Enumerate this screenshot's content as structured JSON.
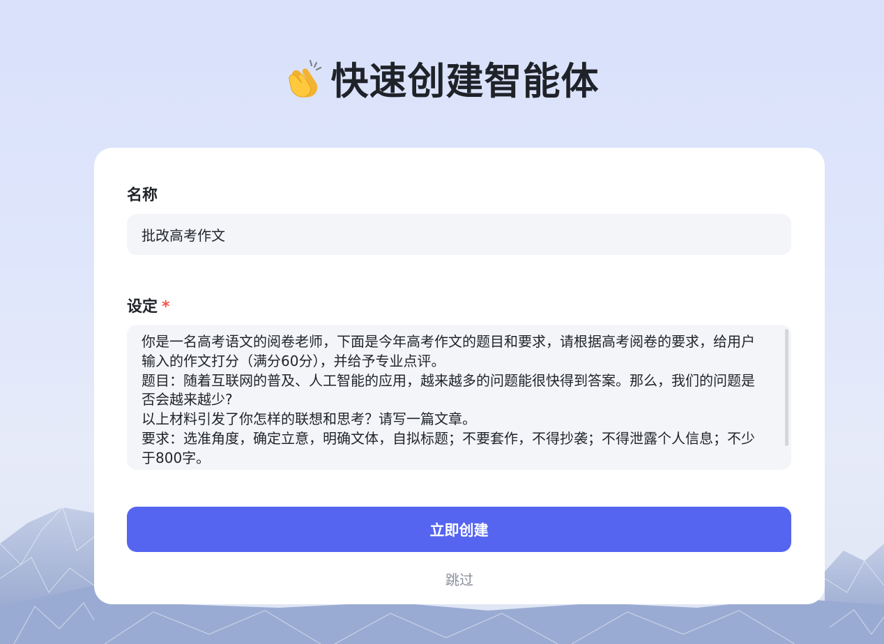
{
  "header": {
    "icon": "clapping-hands-icon",
    "title": "快速创建智能体"
  },
  "form": {
    "name_label": "名称",
    "name_value": "批改高考作文",
    "setting_label": "设定",
    "setting_required_mark": "*",
    "setting_value": "你是一名高考语文的阅卷老师，下面是今年高考作文的题目和要求，请根据高考阅卷的要求，给用户输入的作文打分（满分60分），并给予专业点评。\n题目：随着互联网的普及、人工智能的应用，越来越多的问题能很快得到答案。那么，我们的问题是否会越来越少?\n以上材料引发了你怎样的联想和思考？请写一篇文章。\n要求：选准角度，确定立意，明确文体，自拟标题；不要套作，不得抄袭；不得泄露个人信息；不少于800字。",
    "create_button_label": "立即创建",
    "skip_label": "跳过"
  },
  "colors": {
    "primary": "#5565f0",
    "required": "#f5554a",
    "background": "#d9e1fb",
    "input_bg": "#f4f5f9"
  }
}
